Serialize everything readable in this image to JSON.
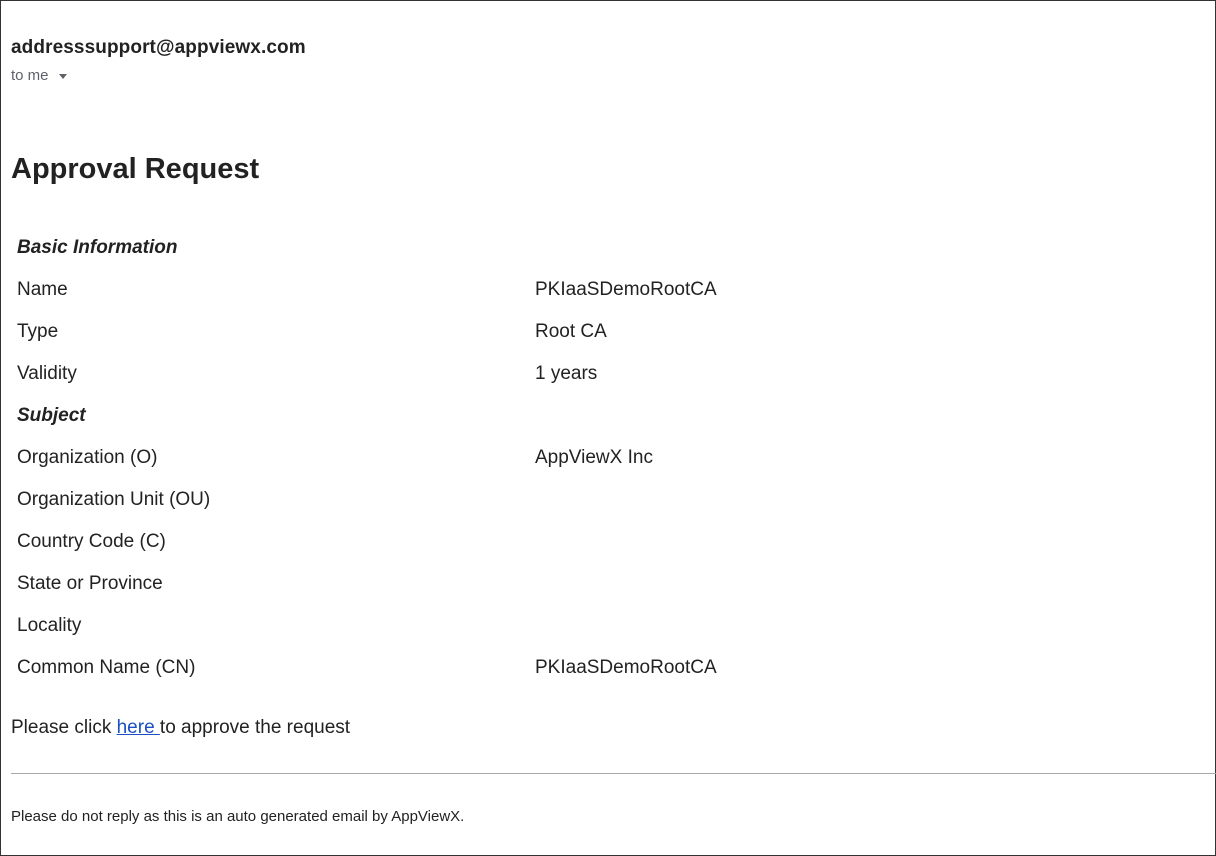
{
  "email": {
    "sender": "addresssupport@appviewx.com",
    "recipient": "to me",
    "title": "Approval Request"
  },
  "basic_information": {
    "heading": "Basic Information",
    "rows": [
      {
        "label": "Name",
        "value": "PKIaaSDemoRootCA"
      },
      {
        "label": "Type",
        "value": "Root CA"
      },
      {
        "label": "Validity",
        "value": "1 years"
      }
    ]
  },
  "subject": {
    "heading": "Subject",
    "rows": [
      {
        "label": "Organization (O)",
        "value": "AppViewX Inc"
      },
      {
        "label": "Organization Unit (OU)",
        "value": ""
      },
      {
        "label": "Country Code (C)",
        "value": ""
      },
      {
        "label": "State or Province",
        "value": ""
      },
      {
        "label": "Locality",
        "value": ""
      },
      {
        "label": "Common Name (CN)",
        "value": "PKIaaSDemoRootCA"
      }
    ]
  },
  "approval": {
    "prefix": "Please click ",
    "link_text": "here ",
    "suffix": "to approve the request"
  },
  "footer": {
    "text": "Please do not reply as this is an auto generated email by AppViewX."
  },
  "colors": {
    "link": "#1a4fc4",
    "muted": "#5f6368",
    "divider": "#a8a8a8"
  },
  "icons": {
    "recipient_details": "caret-down-icon"
  }
}
